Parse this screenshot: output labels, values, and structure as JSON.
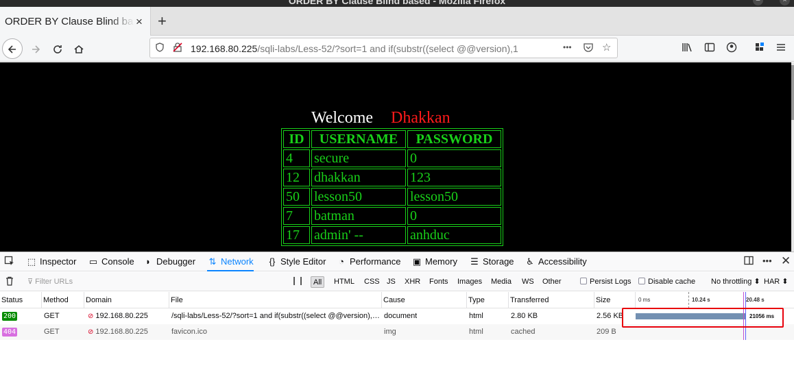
{
  "window": {
    "title": "ORDER BY Clause Blind based - Mozilla Firefox"
  },
  "tab": {
    "label": "ORDER BY Clause Blind based",
    "close": "×",
    "new_tab": "+"
  },
  "nav": {
    "url_host": "192.168.80.225",
    "url_path": "/sqli-labs/Less-52/?sort=1 and if(substr((select @@version),1",
    "more": "•••"
  },
  "page": {
    "welcome": "Welcome",
    "name": "Dhakkan",
    "table": {
      "headers": [
        "ID",
        "USERNAME",
        "PASSWORD"
      ],
      "rows": [
        [
          "4",
          "secure",
          "0"
        ],
        [
          "12",
          "dhakkan",
          "123"
        ],
        [
          "50",
          "lesson50",
          "lesson50"
        ],
        [
          "7",
          "batman",
          "0"
        ],
        [
          "17",
          "admin' --",
          "anhduc"
        ]
      ]
    }
  },
  "devtools": {
    "tabs": [
      "Inspector",
      "Console",
      "Debugger",
      "Network",
      "Style Editor",
      "Performance",
      "Memory",
      "Storage",
      "Accessibility"
    ],
    "active_tab": "Network",
    "filter_placeholder": "Filter URLs",
    "filter_types": [
      "All",
      "HTML",
      "CSS",
      "JS",
      "XHR",
      "Fonts",
      "Images",
      "Media",
      "WS",
      "Other"
    ],
    "persist_logs": "Persist Logs",
    "disable_cache": "Disable cache",
    "throttling": "No throttling ⬍",
    "har": "HAR ⬍",
    "columns": [
      "Status",
      "Method",
      "Domain",
      "File",
      "Cause",
      "Type",
      "Transferred",
      "Size"
    ],
    "timeline_ticks": [
      "0 ms",
      "10.24 s",
      "20.48 s"
    ],
    "requests": [
      {
        "status": "200",
        "method": "GET",
        "domain": "192.168.80.225",
        "file": "/sqli-labs/Less-52/?sort=1 and if(substr((select @@version),…",
        "cause": "document",
        "type": "html",
        "transferred": "2.80 KB",
        "size": "2.56 KB",
        "time": "21056 ms"
      },
      {
        "status": "404",
        "method": "GET",
        "domain": "192.168.80.225",
        "file": "favicon.ico",
        "cause": "img",
        "type": "html",
        "transferred": "cached",
        "size": "209 B"
      }
    ]
  },
  "colors": {
    "accent": "#0a84ff",
    "table_green": "#19d119",
    "dhakkan_red": "#ff1a1a",
    "ok_badge": "#058b00",
    "notfound_badge": "#d86fe0",
    "highlight": "#e8000b"
  }
}
